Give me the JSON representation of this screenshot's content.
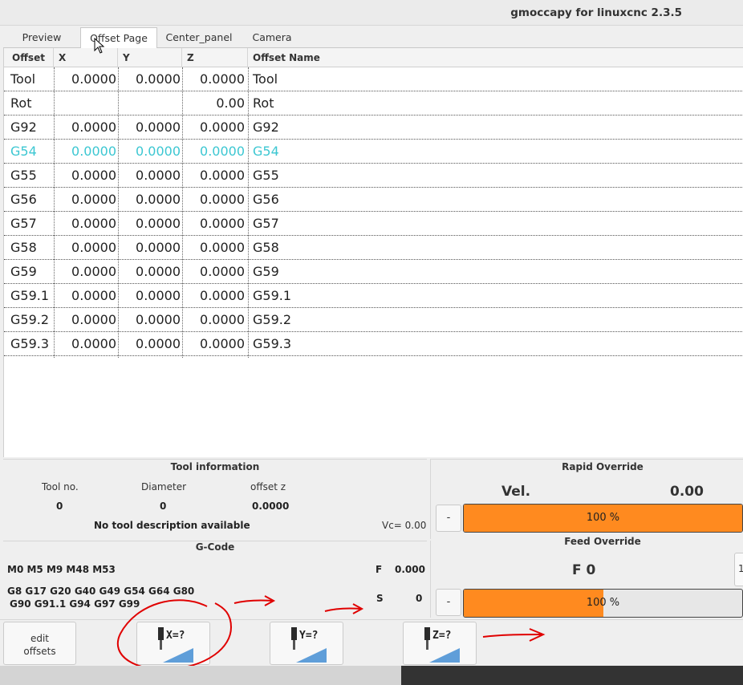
{
  "window": {
    "title": "gmoccapy for linuxcnc  2.3.5"
  },
  "tabs": [
    {
      "label": "Preview",
      "active": false
    },
    {
      "label": "Offset Page",
      "active": true
    },
    {
      "label": "Center_panel",
      "active": false
    },
    {
      "label": "Camera",
      "active": false
    }
  ],
  "offsets": {
    "columns": [
      "Offset",
      "X",
      "Y",
      "Z",
      "Offset Name"
    ],
    "rows": [
      {
        "offset": "Tool",
        "x": "0.0000",
        "y": "0.0000",
        "z": "0.0000",
        "name": "Tool",
        "active": false
      },
      {
        "offset": "Rot",
        "x": "",
        "y": "",
        "z": "0.00",
        "name": "Rot",
        "active": false
      },
      {
        "offset": "G92",
        "x": "0.0000",
        "y": "0.0000",
        "z": "0.0000",
        "name": "G92",
        "active": false
      },
      {
        "offset": "G54",
        "x": "0.0000",
        "y": "0.0000",
        "z": "0.0000",
        "name": "G54",
        "active": true
      },
      {
        "offset": "G55",
        "x": "0.0000",
        "y": "0.0000",
        "z": "0.0000",
        "name": "G55",
        "active": false
      },
      {
        "offset": "G56",
        "x": "0.0000",
        "y": "0.0000",
        "z": "0.0000",
        "name": "G56",
        "active": false
      },
      {
        "offset": "G57",
        "x": "0.0000",
        "y": "0.0000",
        "z": "0.0000",
        "name": "G57",
        "active": false
      },
      {
        "offset": "G58",
        "x": "0.0000",
        "y": "0.0000",
        "z": "0.0000",
        "name": "G58",
        "active": false
      },
      {
        "offset": "G59",
        "x": "0.0000",
        "y": "0.0000",
        "z": "0.0000",
        "name": "G59",
        "active": false
      },
      {
        "offset": "G59.1",
        "x": "0.0000",
        "y": "0.0000",
        "z": "0.0000",
        "name": "G59.1",
        "active": false
      },
      {
        "offset": "G59.2",
        "x": "0.0000",
        "y": "0.0000",
        "z": "0.0000",
        "name": "G59.2",
        "active": false
      },
      {
        "offset": "G59.3",
        "x": "0.0000",
        "y": "0.0000",
        "z": "0.0000",
        "name": "G59.3",
        "active": false
      }
    ]
  },
  "tool_info": {
    "title": "Tool information",
    "tool_no_label": "Tool no.",
    "diameter_label": "Diameter",
    "offset_z_label": "offset z",
    "tool_no": "0",
    "diameter": "0",
    "offset_z": "0.0000",
    "description": "No tool description available",
    "vc": "Vc= 0.00"
  },
  "gcode": {
    "title": "G-Code",
    "mcodes": "M0 M5 M9 M48 M53",
    "gcodes_line1": "G8 G17 G20 G40 G49 G54 G64 G80",
    "gcodes_line2": "G90 G91.1 G94 G97 G99",
    "f_label": "F",
    "f_value": "0.000",
    "s_label": "S",
    "s_value": "0"
  },
  "rapid_override": {
    "title": "Rapid Override",
    "vel_label": "Vel.",
    "vel_value": "0.00",
    "minus_label": "-",
    "percent": 100,
    "percent_text": "100 %"
  },
  "feed_override": {
    "title": "Feed Override",
    "f_label": "F  0",
    "minus_label": "-",
    "percent": 100,
    "percent_text": "100 %",
    "edge_label": "1",
    "filled_fraction": 0.5
  },
  "buttons": {
    "edit_offsets": "edit\noffsets",
    "probe_x": "X=?",
    "probe_y": "Y=?",
    "probe_z": "Z=?"
  },
  "colors": {
    "accent_bar": "#ff8a1f",
    "active_row": "#3cc7d2",
    "annotation": "#e00000"
  }
}
